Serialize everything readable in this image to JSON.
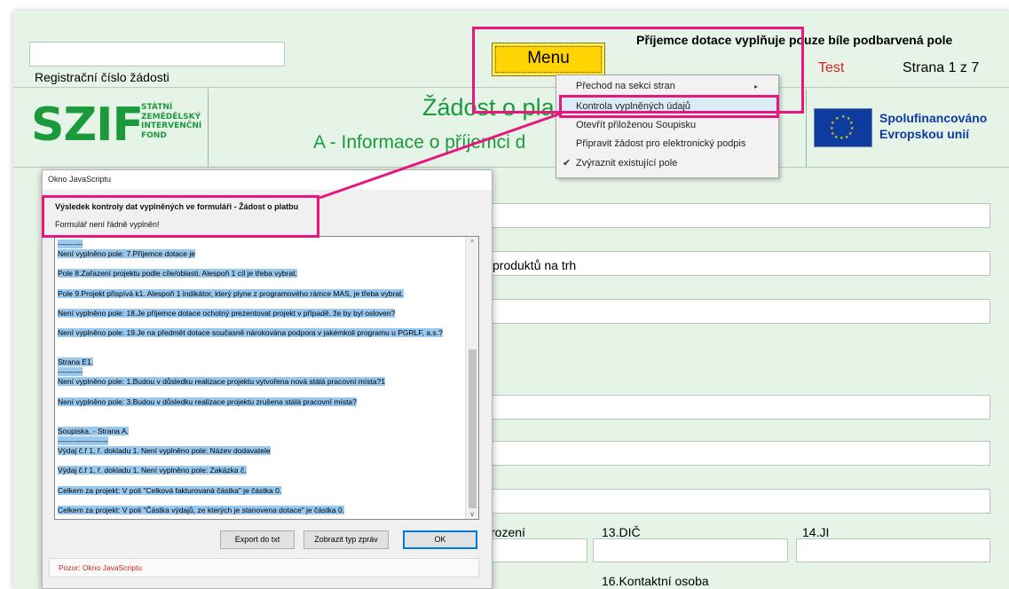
{
  "header": {
    "reg_label": "Registrační číslo žádosti",
    "menu_label": "Menu",
    "notice": "Příjemce dotace vyplňuje pouze bíle podbarvená pole",
    "test_label": "Test",
    "page_label": "Strana 1 z 7"
  },
  "logo": {
    "big": "SZIF",
    "small": [
      "STÁTNÍ",
      "ZEMĚDĚLSKÝ",
      "INTERVENČNÍ",
      "FOND"
    ]
  },
  "titles": {
    "main": "Žádost o pla",
    "sub": "A - Informace o příjemci d"
  },
  "eu": {
    "line1": "Spolufinancováno",
    "line2": "Evropskou unií"
  },
  "form": {
    "products_text": "produktů na trh",
    "label_birth": "rození",
    "label_dic": "13.DIČ",
    "label_ji": "14.JI",
    "label_contact": "16.Kontaktní osoba"
  },
  "context_menu": {
    "items": [
      {
        "label": "Přechod na sekci stran",
        "submenu": true
      },
      {
        "label": "Kontrola vyplněných údajů",
        "highlighted": true
      },
      {
        "label": "Otevřít přiloženou Soupisku"
      },
      {
        "label": "Připravit žádost pro elektronický podpis"
      },
      {
        "label": "Zvýraznit existující pole",
        "checked": true
      }
    ],
    "arrow_glyph": "▸",
    "check_glyph": "✔"
  },
  "dialog": {
    "title": "Okno JavaScriptu",
    "heading": "Výsledek kontroly dat vyplněných ve formuláři - Žádost o platbu",
    "subheading": "Formulář není řádně vyplněn!",
    "messages": [
      "----------",
      "Není vyplněno pole: 7.Příjemce dotace je",
      "",
      "Pole 8.Zařazení projektu podle cíle/oblasti. Alespoň 1 cíl je třeba vybrat.",
      "",
      "Pole 9.Projekt přispívá k1. Alespoň 1 indikátor, který plyne z programového rámce MAS, je třeba vybrat.",
      "",
      "Není vyplněno pole: 18.Je příjemce dotace ochotný prezentovat projekt v případě, že by byl osloven?",
      "",
      "Není vyplněno pole: 19.Je na předmět dotace současně nárokována podpora v jakémkoli programu u PGRLF, a.s.?",
      "",
      "",
      "Strana E1.",
      "----------",
      "Není vyplněno pole: 1.Budou v důsledku realizace projektu vytvořena nová stálá pracovní místa?1",
      "",
      "Není vyplněno pole: 3.Budou v důsledku realizace projektu zrušena stálá pracovní místa?",
      "",
      "",
      "Soupiska. - Strana A.",
      "--------------------",
      "Výdaj č.ř 1, ř. dokladu 1. Není vyplněno pole: Název dodavatele",
      "",
      "Výdaj č.ř 1, ř. dokladu 1. Není vyplněno pole: Zakázka č.",
      "",
      "Celkem za projekt: V poli \"Celková fakturovaná částka\" je částka 0.",
      "",
      "Celkem za projekt: V poli \"Částka výdajů, ze kterých je stanovena dotace\" je částka 0."
    ],
    "btn_export": "Export do txt",
    "btn_show_type": "Zobrazit typ zpráv",
    "btn_ok": "OK",
    "status": "Pozor: Okno JavaScriptu",
    "scroll_up": "^",
    "scroll_down": "v"
  },
  "colors": {
    "page_bg": "#e6f3e7",
    "szif_green": "#1b9a3c",
    "eu_blue": "#0d3c9e",
    "annotation": "#e8177d",
    "menu_yellow": "#ffd400",
    "selection": "#99c9ef",
    "test_red": "#d62020"
  }
}
